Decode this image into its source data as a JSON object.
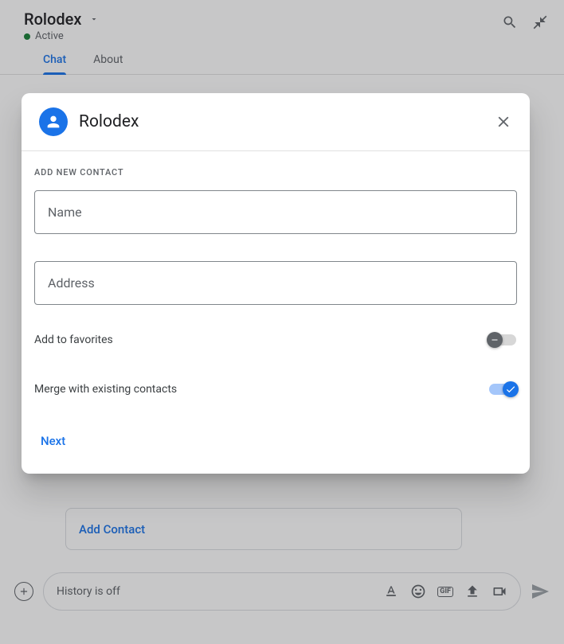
{
  "header": {
    "title": "Rolodex",
    "status": "Active"
  },
  "tabs": {
    "chat": "Chat",
    "about": "About"
  },
  "card": {
    "add_contact": "Add Contact"
  },
  "compose": {
    "placeholder": "History is off",
    "gif_label": "GIF"
  },
  "dialog": {
    "title": "Rolodex",
    "section_label": "Add new contact",
    "name_placeholder": "Name",
    "address_placeholder": "Address",
    "favorites_label": "Add to favorites",
    "merge_label": "Merge with existing contacts",
    "next_label": "Next"
  }
}
